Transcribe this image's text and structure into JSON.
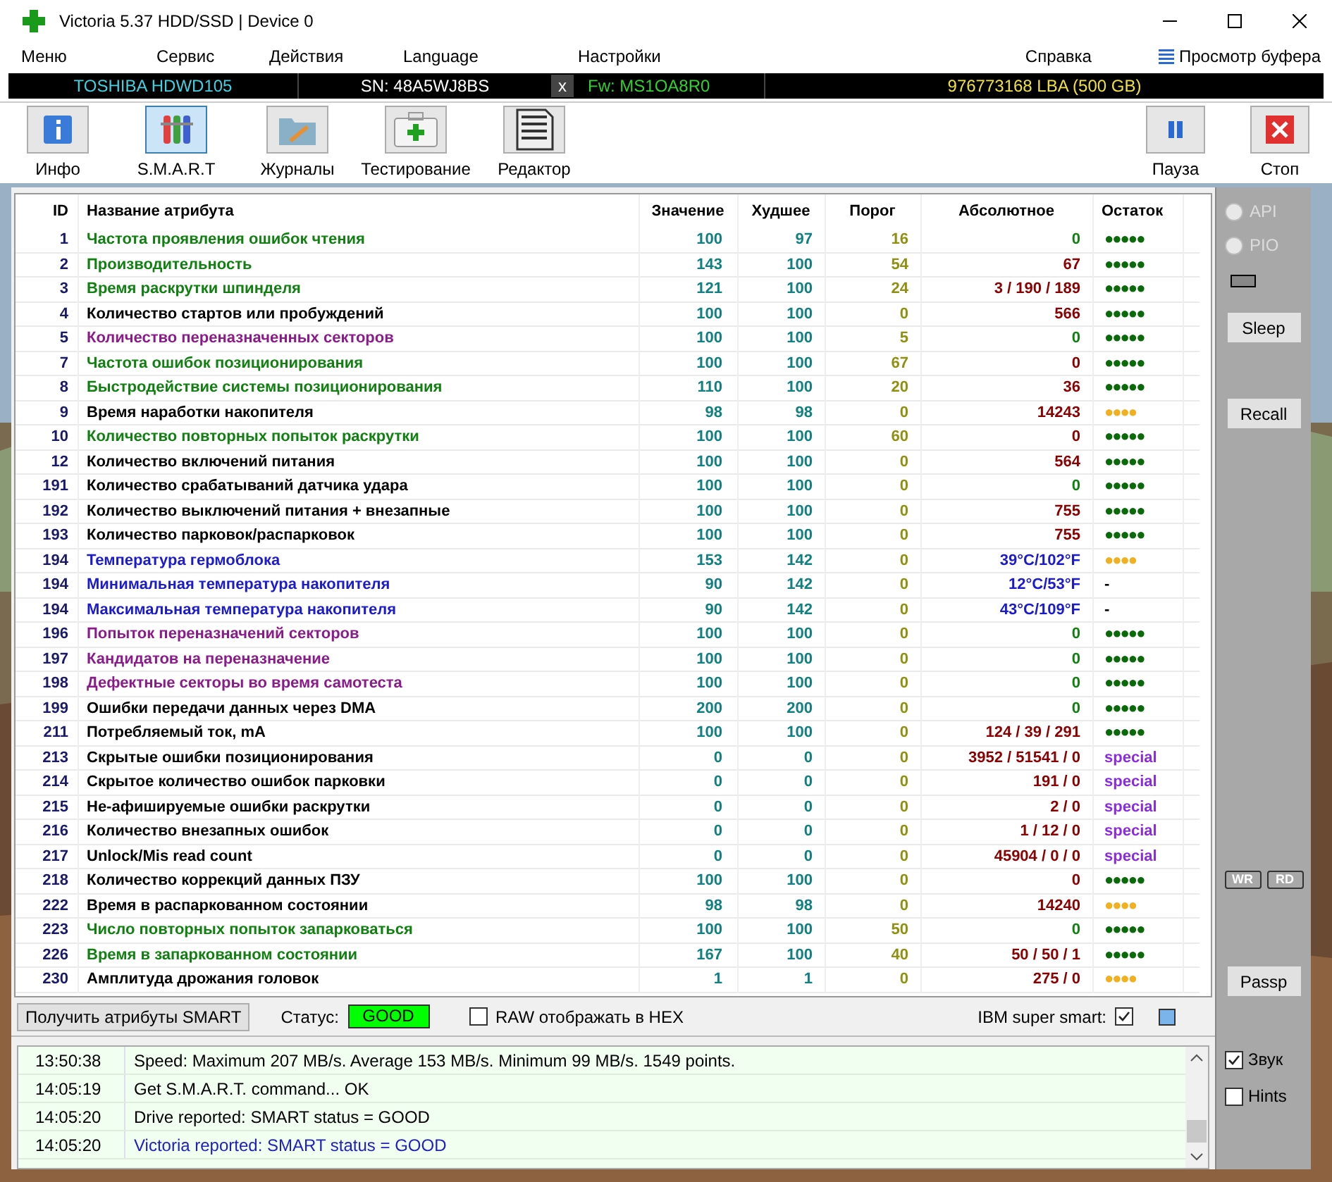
{
  "window": {
    "title": "Victoria 5.37 HDD/SSD | Device 0"
  },
  "menu": {
    "items": [
      "Меню",
      "Сервис",
      "Действия",
      "Language",
      "Настройки"
    ],
    "help": "Справка",
    "buffer": "Просмотр буфера"
  },
  "drive_bar": {
    "model": "TOSHIBA HDWD105",
    "serial": "SN: 48A5WJ8BS",
    "close": "x",
    "firmware": "Fw: MS1OA8R0",
    "capacity": "976773168 LBA (500 GB)"
  },
  "toolbar": [
    {
      "label": "Инфо",
      "kind": "info",
      "selected": false
    },
    {
      "label": "S.M.A.R.T",
      "kind": "smart",
      "selected": true
    },
    {
      "label": "Журналы",
      "kind": "logs",
      "selected": false
    },
    {
      "label": "Тестирование",
      "kind": "test",
      "selected": false
    },
    {
      "label": "Редактор",
      "kind": "editor",
      "selected": false
    }
  ],
  "toolbar_right": [
    {
      "label": "Пауза",
      "kind": "pause"
    },
    {
      "label": "Стоп",
      "kind": "stop"
    }
  ],
  "table": {
    "columns": [
      "ID",
      "Название атрибута",
      "Значение",
      "Худшее",
      "Порог",
      "Абсолютное",
      "Остаток"
    ],
    "rows": [
      {
        "id": "1",
        "name": "Частота проявления ошибок чтения",
        "color": "#108010",
        "value": "100",
        "worst": "97",
        "threshold": "16",
        "raw": {
          "text": "0",
          "kind": "zero"
        },
        "remaining": {
          "text": "●●●●●",
          "kind": "good"
        }
      },
      {
        "id": "2",
        "name": "Производительность",
        "color": "#108010",
        "value": "143",
        "worst": "100",
        "threshold": "54",
        "raw": {
          "text": "67",
          "kind": "count"
        },
        "remaining": {
          "text": "●●●●●",
          "kind": "good"
        }
      },
      {
        "id": "3",
        "name": "Время раскрутки шпинделя",
        "color": "#108010",
        "value": "121",
        "worst": "100",
        "threshold": "24",
        "raw": {
          "text": "3 / 190 / 189",
          "kind": "count"
        },
        "remaining": {
          "text": "●●●●●",
          "kind": "good"
        }
      },
      {
        "id": "4",
        "name": "Количество стартов или пробуждений",
        "color": "#000000",
        "value": "100",
        "worst": "100",
        "threshold": "0",
        "raw": {
          "text": "566",
          "kind": "count"
        },
        "remaining": {
          "text": "●●●●●",
          "kind": "good"
        }
      },
      {
        "id": "5",
        "name": "Количество переназначенных секторов",
        "color": "#8b1a8b",
        "value": "100",
        "worst": "100",
        "threshold": "5",
        "raw": {
          "text": "0",
          "kind": "zero"
        },
        "remaining": {
          "text": "●●●●●",
          "kind": "good"
        }
      },
      {
        "id": "7",
        "name": "Частота ошибок позиционирования",
        "color": "#108010",
        "value": "100",
        "worst": "100",
        "threshold": "67",
        "raw": {
          "text": "0",
          "kind": "count"
        },
        "remaining": {
          "text": "●●●●●",
          "kind": "good"
        }
      },
      {
        "id": "8",
        "name": "Быстродействие системы позиционирования",
        "color": "#108010",
        "value": "110",
        "worst": "100",
        "threshold": "20",
        "raw": {
          "text": "36",
          "kind": "count"
        },
        "remaining": {
          "text": "●●●●●",
          "kind": "good"
        }
      },
      {
        "id": "9",
        "name": "Время наработки накопителя",
        "color": "#000000",
        "value": "98",
        "worst": "98",
        "threshold": "0",
        "raw": {
          "text": "14243",
          "kind": "count"
        },
        "remaining": {
          "text": "●●●●",
          "kind": "warn"
        }
      },
      {
        "id": "10",
        "name": "Количество повторных попыток раскрутки",
        "color": "#108010",
        "value": "100",
        "worst": "100",
        "threshold": "60",
        "raw": {
          "text": "0",
          "kind": "count"
        },
        "remaining": {
          "text": "●●●●●",
          "kind": "good"
        }
      },
      {
        "id": "12",
        "name": "Количество включений питания",
        "color": "#000000",
        "value": "100",
        "worst": "100",
        "threshold": "0",
        "raw": {
          "text": "564",
          "kind": "count"
        },
        "remaining": {
          "text": "●●●●●",
          "kind": "good"
        }
      },
      {
        "id": "191",
        "name": "Количество срабатываний датчика удара",
        "color": "#000000",
        "value": "100",
        "worst": "100",
        "threshold": "0",
        "raw": {
          "text": "0",
          "kind": "zero"
        },
        "remaining": {
          "text": "●●●●●",
          "kind": "good"
        }
      },
      {
        "id": "192",
        "name": "Количество выключений питания + внезапные",
        "color": "#000000",
        "value": "100",
        "worst": "100",
        "threshold": "0",
        "raw": {
          "text": "755",
          "kind": "count"
        },
        "remaining": {
          "text": "●●●●●",
          "kind": "good"
        }
      },
      {
        "id": "193",
        "name": "Количество парковок/распарковок",
        "color": "#000000",
        "value": "100",
        "worst": "100",
        "threshold": "0",
        "raw": {
          "text": "755",
          "kind": "count"
        },
        "remaining": {
          "text": "●●●●●",
          "kind": "good"
        }
      },
      {
        "id": "194",
        "name": "Температура гермоблока",
        "color": "#1a1ad0",
        "value": "153",
        "worst": "142",
        "threshold": "0",
        "raw": {
          "text": "39°C/102°F",
          "kind": "temp"
        },
        "remaining": {
          "text": "●●●●",
          "kind": "warn"
        }
      },
      {
        "id": "194",
        "name": "Минимальная температура накопителя",
        "color": "#1a1ad0",
        "value": "90",
        "worst": "142",
        "threshold": "0",
        "raw": {
          "text": "12°C/53°F",
          "kind": "temp"
        },
        "remaining": {
          "text": "-",
          "kind": "none"
        }
      },
      {
        "id": "194",
        "name": "Максимальная температура накопителя",
        "color": "#1a1ad0",
        "value": "90",
        "worst": "142",
        "threshold": "0",
        "raw": {
          "text": "43°C/109°F",
          "kind": "temp"
        },
        "remaining": {
          "text": "-",
          "kind": "none"
        }
      },
      {
        "id": "196",
        "name": "Попыток переназначений секторов",
        "color": "#8b1a8b",
        "value": "100",
        "worst": "100",
        "threshold": "0",
        "raw": {
          "text": "0",
          "kind": "zero"
        },
        "remaining": {
          "text": "●●●●●",
          "kind": "good"
        }
      },
      {
        "id": "197",
        "name": "Кандидатов на переназначение",
        "color": "#8b1a8b",
        "value": "100",
        "worst": "100",
        "threshold": "0",
        "raw": {
          "text": "0",
          "kind": "zero"
        },
        "remaining": {
          "text": "●●●●●",
          "kind": "good"
        }
      },
      {
        "id": "198",
        "name": "Дефектные секторы во время самотеста",
        "color": "#8b1a8b",
        "value": "100",
        "worst": "100",
        "threshold": "0",
        "raw": {
          "text": "0",
          "kind": "zero"
        },
        "remaining": {
          "text": "●●●●●",
          "kind": "good"
        }
      },
      {
        "id": "199",
        "name": "Ошибки передачи данных через DMA",
        "color": "#000000",
        "value": "200",
        "worst": "200",
        "threshold": "0",
        "raw": {
          "text": "0",
          "kind": "zero"
        },
        "remaining": {
          "text": "●●●●●",
          "kind": "good"
        }
      },
      {
        "id": "211",
        "name": "Потребляемый ток, mA",
        "color": "#000000",
        "value": "100",
        "worst": "100",
        "threshold": "0",
        "raw": {
          "text": "124 / 39 / 291",
          "kind": "count"
        },
        "remaining": {
          "text": "●●●●●",
          "kind": "good"
        }
      },
      {
        "id": "213",
        "name": "Скрытые ошибки позиционирования",
        "color": "#000000",
        "value": "0",
        "worst": "0",
        "threshold": "0",
        "raw": {
          "text": "3952 / 51541 / 0",
          "kind": "count"
        },
        "remaining": {
          "text": "special",
          "kind": "special"
        }
      },
      {
        "id": "214",
        "name": "Скрытое количество ошибок парковки",
        "color": "#000000",
        "value": "0",
        "worst": "0",
        "threshold": "0",
        "raw": {
          "text": "191 / 0",
          "kind": "count"
        },
        "remaining": {
          "text": "special",
          "kind": "special"
        }
      },
      {
        "id": "215",
        "name": "Не-афишируемые ошибки раскрутки",
        "color": "#000000",
        "value": "0",
        "worst": "0",
        "threshold": "0",
        "raw": {
          "text": "2 / 0",
          "kind": "count"
        },
        "remaining": {
          "text": "special",
          "kind": "special"
        }
      },
      {
        "id": "216",
        "name": "Количество внезапных ошибок",
        "color": "#000000",
        "value": "0",
        "worst": "0",
        "threshold": "0",
        "raw": {
          "text": "1 / 12 / 0",
          "kind": "count"
        },
        "remaining": {
          "text": "special",
          "kind": "special"
        }
      },
      {
        "id": "217",
        "name": "Unlock/Mis read count",
        "color": "#000000",
        "value": "0",
        "worst": "0",
        "threshold": "0",
        "raw": {
          "text": "45904 / 0 / 0",
          "kind": "count"
        },
        "remaining": {
          "text": "special",
          "kind": "special"
        }
      },
      {
        "id": "218",
        "name": "Количество коррекций данных ПЗУ",
        "color": "#000000",
        "value": "100",
        "worst": "100",
        "threshold": "0",
        "raw": {
          "text": "0",
          "kind": "count"
        },
        "remaining": {
          "text": "●●●●●",
          "kind": "good"
        }
      },
      {
        "id": "222",
        "name": "Время в распаркованном состоянии",
        "color": "#000000",
        "value": "98",
        "worst": "98",
        "threshold": "0",
        "raw": {
          "text": "14240",
          "kind": "count"
        },
        "remaining": {
          "text": "●●●●",
          "kind": "warn"
        }
      },
      {
        "id": "223",
        "name": "Число повторных попыток запарковаться",
        "color": "#108010",
        "value": "100",
        "worst": "100",
        "threshold": "50",
        "raw": {
          "text": "0",
          "kind": "zero"
        },
        "remaining": {
          "text": "●●●●●",
          "kind": "good"
        }
      },
      {
        "id": "226",
        "name": "Время в запаркованном состоянии",
        "color": "#108010",
        "value": "167",
        "worst": "100",
        "threshold": "40",
        "raw": {
          "text": "50 / 50 / 1",
          "kind": "count"
        },
        "remaining": {
          "text": "●●●●●",
          "kind": "good"
        }
      },
      {
        "id": "230",
        "name": "Амплитуда дрожания головок",
        "color": "#000000",
        "value": "1",
        "worst": "1",
        "threshold": "0",
        "raw": {
          "text": "275 / 0",
          "kind": "count"
        },
        "remaining": {
          "text": "●●●●",
          "kind": "warn"
        }
      }
    ]
  },
  "status_bar": {
    "get_button": "Получить атрибуты SMART",
    "status_label": "Статус:",
    "status": "GOOD",
    "raw_hex": {
      "label": "RAW отображать в HEX",
      "checked": false
    },
    "ibm": {
      "label": "IBM super smart:",
      "checked": true
    }
  },
  "side_panel": {
    "api": {
      "label": "API",
      "selected": false,
      "disabled": true
    },
    "pio": {
      "label": "PIO",
      "selected": false,
      "disabled": true
    },
    "sleep": "Sleep",
    "recall": "Recall",
    "wr": "WR",
    "rd": "RD",
    "passp": "Passp"
  },
  "log": [
    {
      "time": "13:50:38",
      "message": "Speed: Maximum 207 MB/s. Average 153 MB/s. Minimum 99 MB/s. 1549 points.",
      "highlight": false
    },
    {
      "time": "14:05:19",
      "message": "Get S.M.A.R.T. command... OK",
      "highlight": false
    },
    {
      "time": "14:05:20",
      "message": "Drive reported: SMART status = GOOD",
      "highlight": false
    },
    {
      "time": "14:05:20",
      "message": "Victoria reported: SMART status = GOOD",
      "highlight": true
    }
  ],
  "options": [
    {
      "label": "Звук",
      "checked": true
    },
    {
      "label": "Hints",
      "checked": false
    }
  ]
}
